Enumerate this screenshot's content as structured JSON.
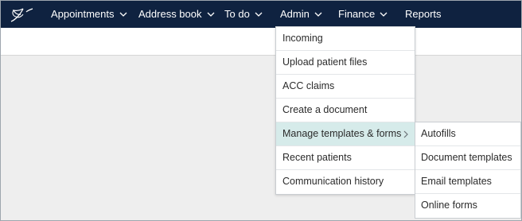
{
  "navbar": {
    "logo_icon": "feather-logo-icon",
    "background": "#0f2240",
    "items": [
      {
        "label": "Appointments",
        "has_dropdown": true
      },
      {
        "label": "Address book",
        "has_dropdown": true
      },
      {
        "label": "To do",
        "has_dropdown": true
      },
      {
        "label": "Admin",
        "has_dropdown": true
      },
      {
        "label": "Finance",
        "has_dropdown": true
      },
      {
        "label": "Reports",
        "has_dropdown": false
      }
    ]
  },
  "admin_menu": {
    "items": [
      {
        "label": "Incoming"
      },
      {
        "label": "Upload patient files"
      },
      {
        "label": "ACC claims"
      },
      {
        "label": "Create a document"
      },
      {
        "label": "Manage templates & forms",
        "active": true,
        "has_submenu": true
      },
      {
        "label": "Recent patients"
      },
      {
        "label": "Communication history"
      }
    ],
    "active_color": "#d6ebea"
  },
  "templates_submenu": {
    "items": [
      {
        "label": "Autofills"
      },
      {
        "label": "Document templates"
      },
      {
        "label": "Email templates"
      },
      {
        "label": "Online forms"
      }
    ]
  }
}
